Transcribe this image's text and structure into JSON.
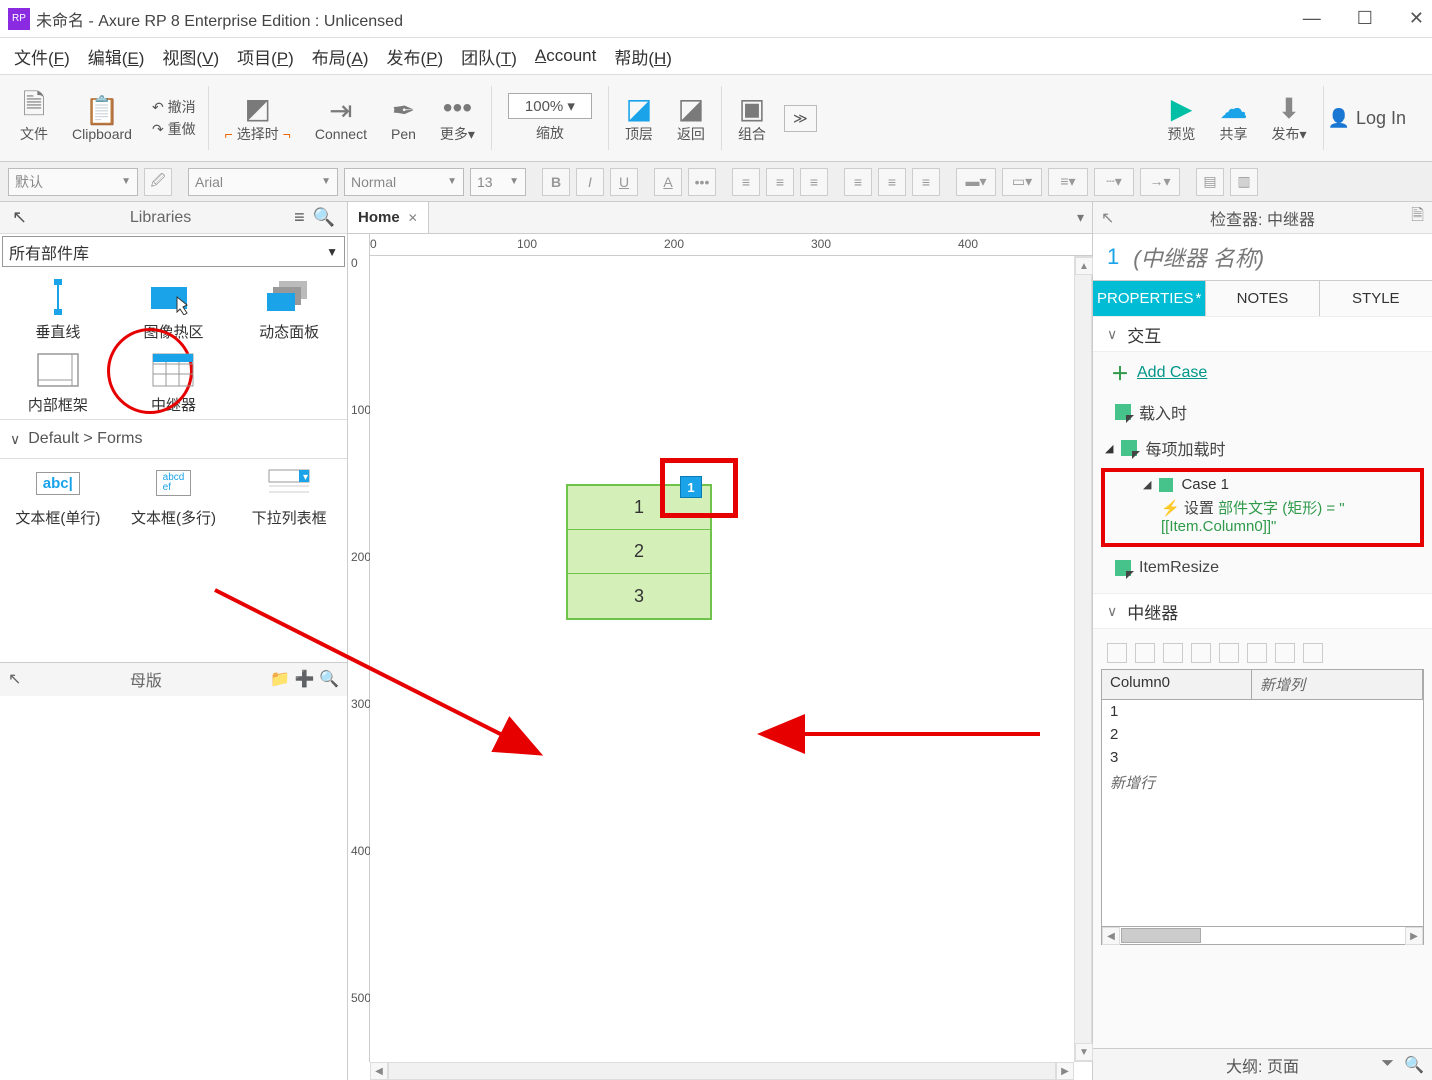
{
  "titlebar": {
    "title": "未命名 - Axure RP 8 Enterprise Edition : Unlicensed"
  },
  "menubar": {
    "file": "文件(F)",
    "edit": "编辑(E)",
    "view": "视图(V)",
    "project": "项目(P)",
    "layout": "布局(A)",
    "publish": "发布(P)",
    "team": "团队(T)",
    "account": "Account",
    "help": "帮助(H)"
  },
  "toolbar": {
    "file": "文件",
    "clipboard": "Clipboard",
    "undo": "撤消",
    "redo": "重做",
    "select": "选择时",
    "connect": "Connect",
    "pen": "Pen",
    "more": "更多▾",
    "zoom_value": "100%",
    "zoom_label": "缩放",
    "front": "顶层",
    "back": "返回",
    "group": "组合",
    "preview": "预览",
    "share": "共享",
    "publish": "发布▾",
    "login": "Log In"
  },
  "formatbar": {
    "style": "默认",
    "font": "Arial",
    "weight": "Normal",
    "size": "13"
  },
  "libraries": {
    "title": "Libraries",
    "selector": "所有部件库",
    "widgets_row1": {
      "a": "垂直线",
      "b": "图像热区",
      "c": "动态面板"
    },
    "widgets_row2": {
      "a": "内部框架",
      "b": "中继器"
    },
    "forms_head": "Default > Forms",
    "widgets_row3": {
      "a": "文本框(单行)",
      "b": "文本框(多行)",
      "c": "下拉列表框"
    },
    "masters": "母版"
  },
  "canvas": {
    "tab": "Home",
    "ruler_h": [
      "0",
      "100",
      "200",
      "300",
      "400"
    ],
    "ruler_v": [
      "0",
      "100",
      "200",
      "300",
      "400",
      "500"
    ],
    "repeater": [
      "1",
      "2",
      "3"
    ],
    "tag": "1"
  },
  "inspector": {
    "header": "检查器: 中继器",
    "index": "1",
    "name_placeholder": "(中继器 名称)",
    "tabs": {
      "properties": "PROPERTIES",
      "notes": "NOTES",
      "style": "STYLE"
    },
    "section_interactions": "交互",
    "add_case": "Add Case",
    "events": {
      "onload": "载入时",
      "itemload": "每项加载时",
      "itemresize": "ItemResize"
    },
    "case": {
      "name": "Case 1",
      "action_prefix": "设置",
      "action_green": "部件文字 (矩形) = \"[[Item.Column0]]\""
    },
    "section_repeater": "中继器",
    "table": {
      "col0": "Column0",
      "newcol": "新增列",
      "rows": [
        "1",
        "2",
        "3"
      ],
      "newrow": "新增行"
    },
    "outline": "大纲: 页面"
  }
}
